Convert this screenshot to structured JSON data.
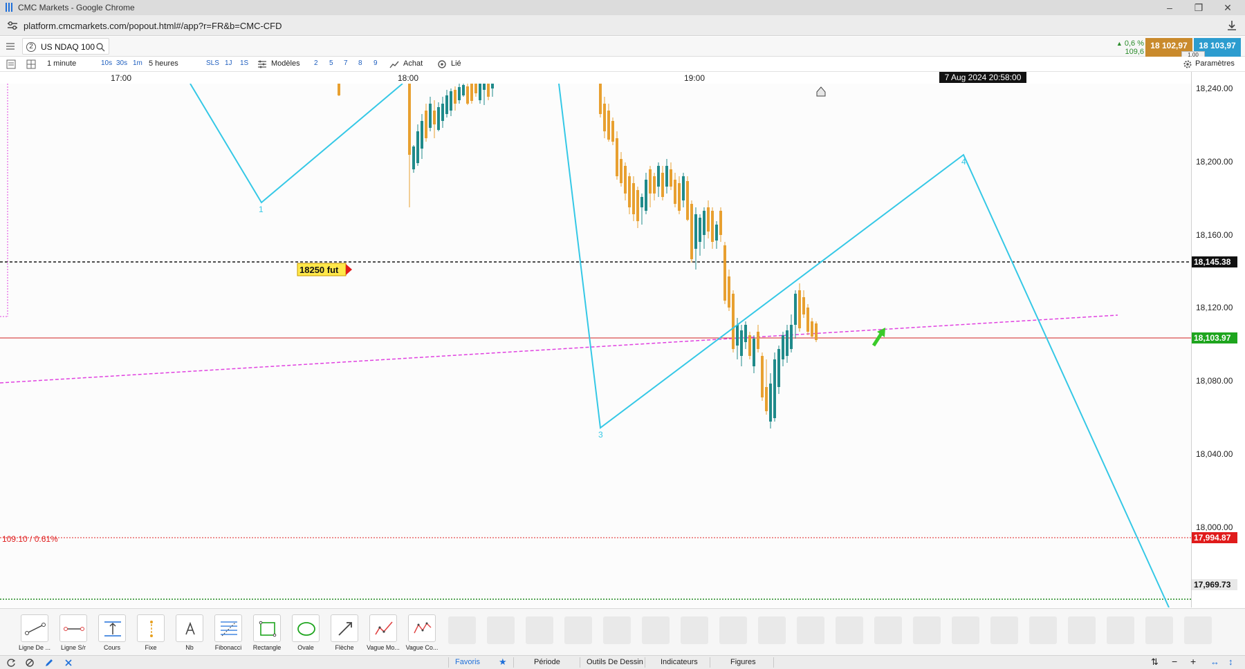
{
  "window": {
    "title": "CMC Markets - Google Chrome",
    "url": "platform.cmcmarkets.com/popout.html#/app?r=FR&b=CMC-CFD"
  },
  "instrument": {
    "tab_number": "2",
    "name": "US NDAQ 100"
  },
  "quote": {
    "change_pct": "0,6 %",
    "change_pts": "109,6",
    "sell": "18 102,97",
    "buy": "18 103,97",
    "spread": "1.00",
    "colors": {
      "sell": "#c98a2c",
      "buy": "#2c9ccf",
      "up": "#2a8c2a"
    }
  },
  "toolbar": {
    "interval": "1 minute",
    "quick_intervals": [
      "10s",
      "30s",
      "1m"
    ],
    "range": "5 heures",
    "quick_ranges": [
      "SLS",
      "1J",
      "1S"
    ],
    "templates_label": "Modèles",
    "template_numbers": [
      "2",
      "5",
      "7",
      "8",
      "9"
    ],
    "buy_label": "Achat",
    "link_label": "Lié",
    "settings_label": "Paramètres"
  },
  "time_axis": {
    "ticks": [
      "17:00",
      "18:00",
      "19:00"
    ],
    "cursor_date": "7 Aug 2024 20:58:00"
  },
  "price_axis": {
    "levels": [
      "18,240.00",
      "18,200.00",
      "18,160.00",
      "18,120.00",
      "18,080.00",
      "18,040.00",
      "18,000.00"
    ],
    "tags": [
      {
        "label": "18,145.38",
        "value": 18145.38,
        "bg": "#111111",
        "fg": "#ffffff"
      },
      {
        "label": "18,103.97",
        "value": 18103.97,
        "bg": "#1ea51e",
        "fg": "#ffffff"
      },
      {
        "label": "17,994.87",
        "value": 17994.87,
        "bg": "#e01b1b",
        "fg": "#ffffff"
      },
      {
        "label": "17,969.73",
        "value": 17969.73,
        "bg": "#e8e8e8",
        "fg": "#111111"
      }
    ]
  },
  "chart_annotations": {
    "level_label": "18250 fut",
    "change_label": "109.10 / 0.61%",
    "wave_labels": [
      "1",
      "3",
      "4"
    ],
    "colors": {
      "wave": "#35c8e6",
      "candle": "#e8a030",
      "trend": "#e040e0",
      "price_line": "#d02020"
    }
  },
  "drawing_tools": [
    {
      "name": "line-draw",
      "label": "Ligne De ..."
    },
    {
      "name": "line-sr",
      "label": "Ligne S/r"
    },
    {
      "name": "price",
      "label": "Cours"
    },
    {
      "name": "fixed",
      "label": "Fixe"
    },
    {
      "name": "text",
      "label": "Nb"
    },
    {
      "name": "fibonacci",
      "label": "Fibonacci"
    },
    {
      "name": "rectangle",
      "label": "Rectangle"
    },
    {
      "name": "oval",
      "label": "Ovale"
    },
    {
      "name": "arrow",
      "label": "Flèche"
    },
    {
      "name": "wave-mo",
      "label": "Vague Mo..."
    },
    {
      "name": "wave-co",
      "label": "Vague Co..."
    }
  ],
  "bottom_tabs": [
    "Favoris",
    "Période",
    "Outils De Dessin",
    "Indicateurs",
    "Figures"
  ]
}
